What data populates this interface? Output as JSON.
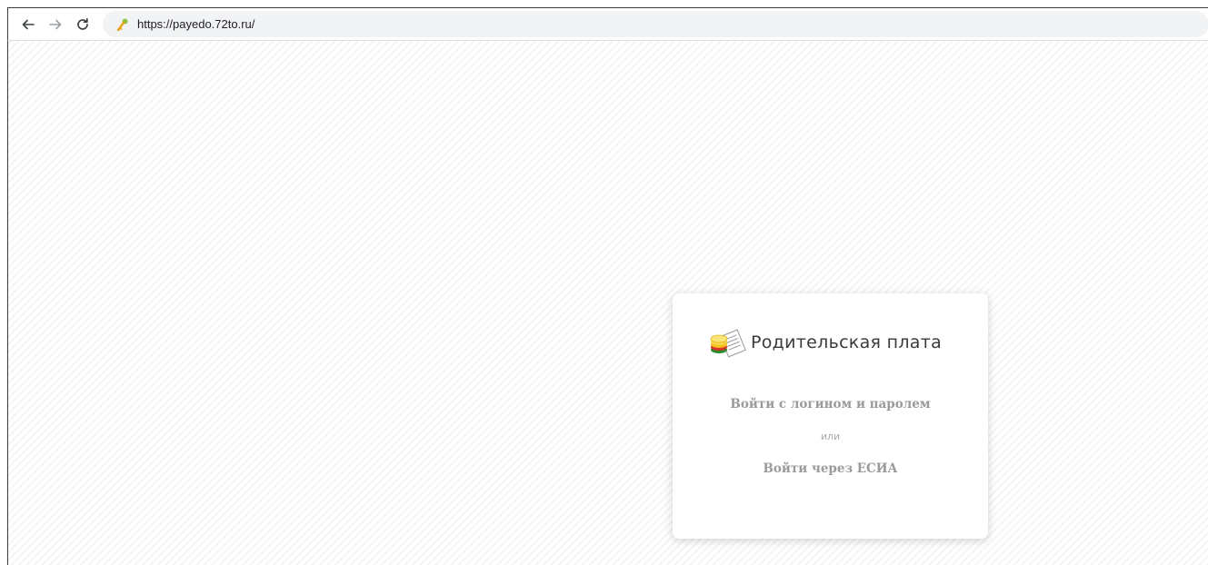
{
  "browser": {
    "url": "https://payedo.72to.ru/",
    "icons": {
      "back": "arrow-left-icon",
      "forward": "arrow-right-icon",
      "reload": "reload-icon",
      "site": "key-icon"
    }
  },
  "login_card": {
    "brand_title": "Родительская плата",
    "login_password_link": "Войти с логином и паролем",
    "or_label": "или",
    "esia_link": "Войти через ЕСИА"
  },
  "colors": {
    "link_text": "#9a9a9a",
    "key_icon": "#8cc63f"
  }
}
